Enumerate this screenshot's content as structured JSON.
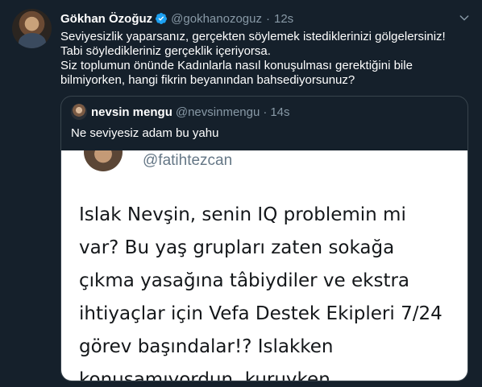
{
  "tweet": {
    "author_name": "Gökhan Özoğuz",
    "author_handle": "@gokhanozoguz",
    "separator": "·",
    "time": "12s",
    "verified_icon": "verified-badge-icon",
    "lines": [
      "Seviyesizlik yaparsanız, gerçekten söylemek istediklerinizi gölgelersiniz!",
      "Tabi söyledikleriniz gerçeklik içeriyorsa.",
      "Siz toplumun önünde Kadınlarla nasıl konuşulması gerektiğini bile",
      "bilmiyorken, hangi fikrin beyanından bahsediyorsunuz?"
    ]
  },
  "quote": {
    "author_name": "nevsin mengu",
    "author_handle": "@nevsinmengu",
    "separator": "·",
    "time": "14s",
    "text": "Ne seviyesiz adam bu yahu",
    "media": {
      "handle": "@fatihtezcan",
      "lines": [
        "Islak Nevşin, senin IQ problemin mi",
        "var? Bu yaş grupları zaten sokağa",
        "çıkma yasağına tâbiydiler ve ekstra",
        "ihtiyaçlar için Vefa Destek Ekipleri 7/24",
        "görev başındalar!?  Islakken",
        "konuşamıyordun, kuruyken"
      ]
    }
  },
  "colors": {
    "background": "#15202b",
    "secondary_text": "#8899a6",
    "verified": "#1da1f2",
    "border": "#38444d"
  }
}
